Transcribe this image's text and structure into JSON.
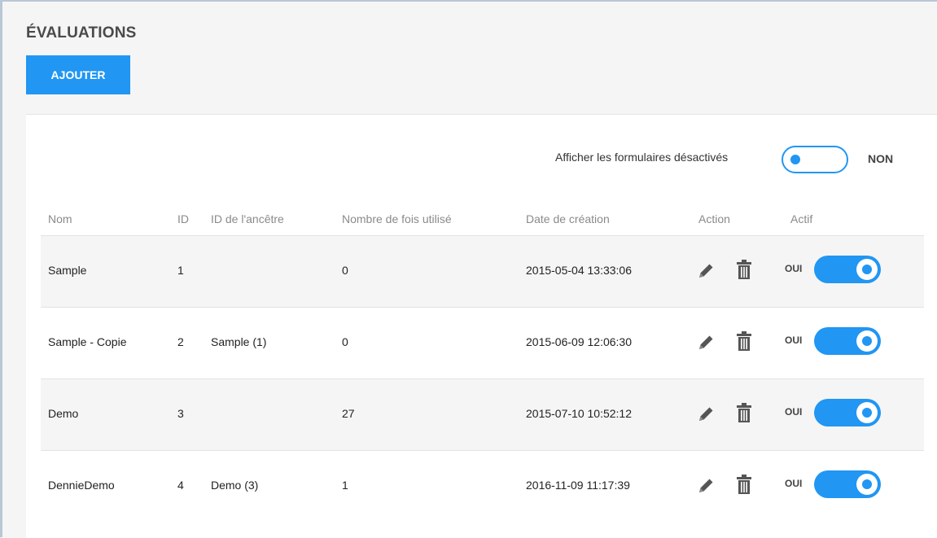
{
  "page": {
    "title": "ÉVALUATIONS",
    "add_label": "AJOUTER"
  },
  "filter": {
    "label": "Afficher les formulaires désactivés",
    "value": "NON"
  },
  "columns": {
    "name": "Nom",
    "id": "ID",
    "ancestor": "ID de l'ancêtre",
    "uses": "Nombre de fois utilisé",
    "created": "Date de création",
    "action": "Action",
    "active": "Actif"
  },
  "rows": [
    {
      "name": "Sample",
      "id": "1",
      "ancestor": "",
      "uses": "0",
      "created": "2015-05-04 13:33:06",
      "active_label": "OUI"
    },
    {
      "name": "Sample - Copie",
      "id": "2",
      "ancestor": "Sample (1)",
      "uses": "0",
      "created": "2015-06-09 12:06:30",
      "active_label": "OUI"
    },
    {
      "name": "Demo",
      "id": "3",
      "ancestor": "",
      "uses": "27",
      "created": "2015-07-10 10:52:12",
      "active_label": "OUI"
    },
    {
      "name": "DennieDemo",
      "id": "4",
      "ancestor": "Demo (3)",
      "uses": "1",
      "created": "2016-11-09 11:17:39",
      "active_label": "OUI"
    }
  ],
  "icons": {
    "edit": "pencil-icon",
    "delete": "trash-icon"
  },
  "colors": {
    "accent": "#2196f3",
    "row_shade": "#f5f5f5"
  }
}
